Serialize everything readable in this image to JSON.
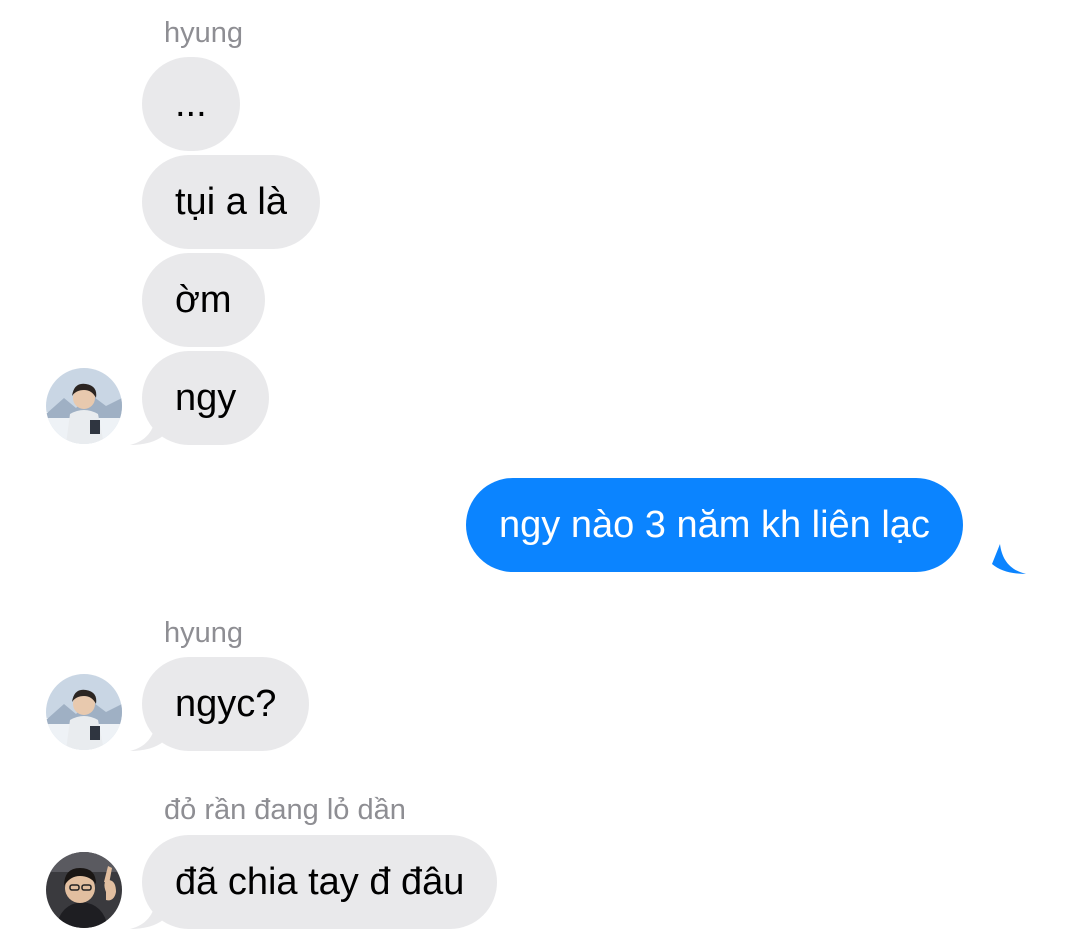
{
  "colors": {
    "incoming_bubble": "#e9e9eb",
    "outgoing_bubble": "#0b84ff",
    "sender_label": "#8e8e93"
  },
  "conversation": {
    "group1": {
      "sender": "hyung",
      "messages": [
        "...",
        "tụi a là",
        "ờm",
        "ngy"
      ]
    },
    "outgoing": {
      "message": "ngy nào 3 năm kh liên lạc"
    },
    "group2": {
      "sender": "hyung",
      "message": "ngyc?"
    },
    "group3": {
      "sender": "đỏ rần đang lỏ dần",
      "message": "đã chia tay đ đâu"
    }
  },
  "avatars": {
    "hyung": "person-in-snow-avatar",
    "second_sender": "person-waving-avatar"
  }
}
